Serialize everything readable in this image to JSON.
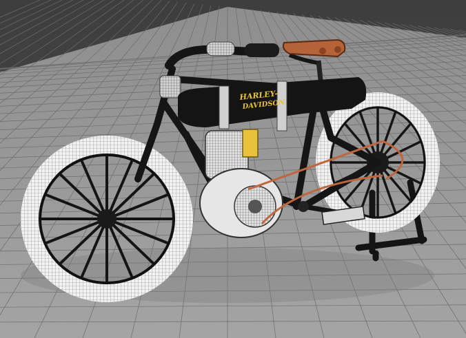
{
  "scene": {
    "subject": "vintage-motorcycle-wireframe-render",
    "tank_text_line1": "HARLEY-",
    "tank_text_line2": "DAVIDSON",
    "colors": {
      "background_top": "#454545",
      "ground": "#9a9a9a",
      "grid_line": "#6e6e6e",
      "frame": "#141414",
      "tire": "#f2f2f2",
      "tank_lettering": "#e8c23a",
      "seat_leather": "#b5643a",
      "belt": "#c0663c",
      "engine_fins": "#e0e0e0"
    }
  }
}
